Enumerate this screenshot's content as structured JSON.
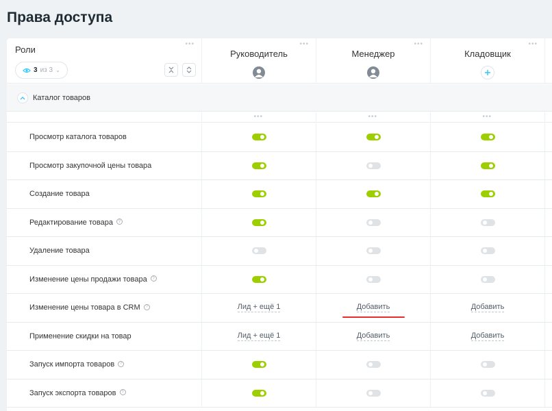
{
  "page": {
    "title": "Права доступа"
  },
  "roles_header": {
    "label": "Роли",
    "filter": {
      "count": "3",
      "of_total": "из 3"
    }
  },
  "roles": [
    {
      "name": "Руководитель",
      "has_avatar": true
    },
    {
      "name": "Менеджер",
      "has_avatar": true
    },
    {
      "name": "Кладовщик",
      "has_avatar": false
    }
  ],
  "section": {
    "title": "Каталог товаров"
  },
  "permissions": [
    {
      "label": "Просмотр каталога товаров",
      "help": false,
      "values": [
        {
          "type": "toggle",
          "on": true
        },
        {
          "type": "toggle",
          "on": true
        },
        {
          "type": "toggle",
          "on": true
        }
      ]
    },
    {
      "label": "Просмотр закупочной цены товара",
      "help": false,
      "values": [
        {
          "type": "toggle",
          "on": true
        },
        {
          "type": "toggle",
          "on": false
        },
        {
          "type": "toggle",
          "on": true
        }
      ]
    },
    {
      "label": "Создание товара",
      "help": false,
      "values": [
        {
          "type": "toggle",
          "on": true
        },
        {
          "type": "toggle",
          "on": true
        },
        {
          "type": "toggle",
          "on": true
        }
      ]
    },
    {
      "label": "Редактирование товара",
      "help": true,
      "values": [
        {
          "type": "toggle",
          "on": true
        },
        {
          "type": "toggle",
          "on": false
        },
        {
          "type": "toggle",
          "on": false
        }
      ]
    },
    {
      "label": "Удаление товара",
      "help": false,
      "values": [
        {
          "type": "toggle",
          "on": false
        },
        {
          "type": "toggle",
          "on": false
        },
        {
          "type": "toggle",
          "on": false
        }
      ]
    },
    {
      "label": "Изменение цены продажи товара",
      "help": true,
      "values": [
        {
          "type": "toggle",
          "on": true
        },
        {
          "type": "toggle",
          "on": false
        },
        {
          "type": "toggle",
          "on": false
        }
      ]
    },
    {
      "label": "Изменение цены товара в CRM",
      "help": true,
      "values": [
        {
          "type": "link",
          "text": "Лид + ещё 1"
        },
        {
          "type": "link",
          "text": "Добавить"
        },
        {
          "type": "link",
          "text": "Добавить"
        }
      ]
    },
    {
      "label": "Применение скидки на товар",
      "help": false,
      "values": [
        {
          "type": "link",
          "text": "Лид + ещё 1"
        },
        {
          "type": "link",
          "text": "Добавить"
        },
        {
          "type": "link",
          "text": "Добавить"
        }
      ]
    },
    {
      "label": "Запуск импорта товаров",
      "help": true,
      "values": [
        {
          "type": "toggle",
          "on": true
        },
        {
          "type": "toggle",
          "on": false
        },
        {
          "type": "toggle",
          "on": false
        }
      ]
    },
    {
      "label": "Запуск экспорта товаров",
      "help": true,
      "values": [
        {
          "type": "toggle",
          "on": true
        },
        {
          "type": "toggle",
          "on": false
        },
        {
          "type": "toggle",
          "on": false
        }
      ]
    }
  ],
  "colors": {
    "toggle_on": "#9dcf00",
    "toggle_off": "#dfe3e6",
    "annotation": "#e62d2d"
  }
}
